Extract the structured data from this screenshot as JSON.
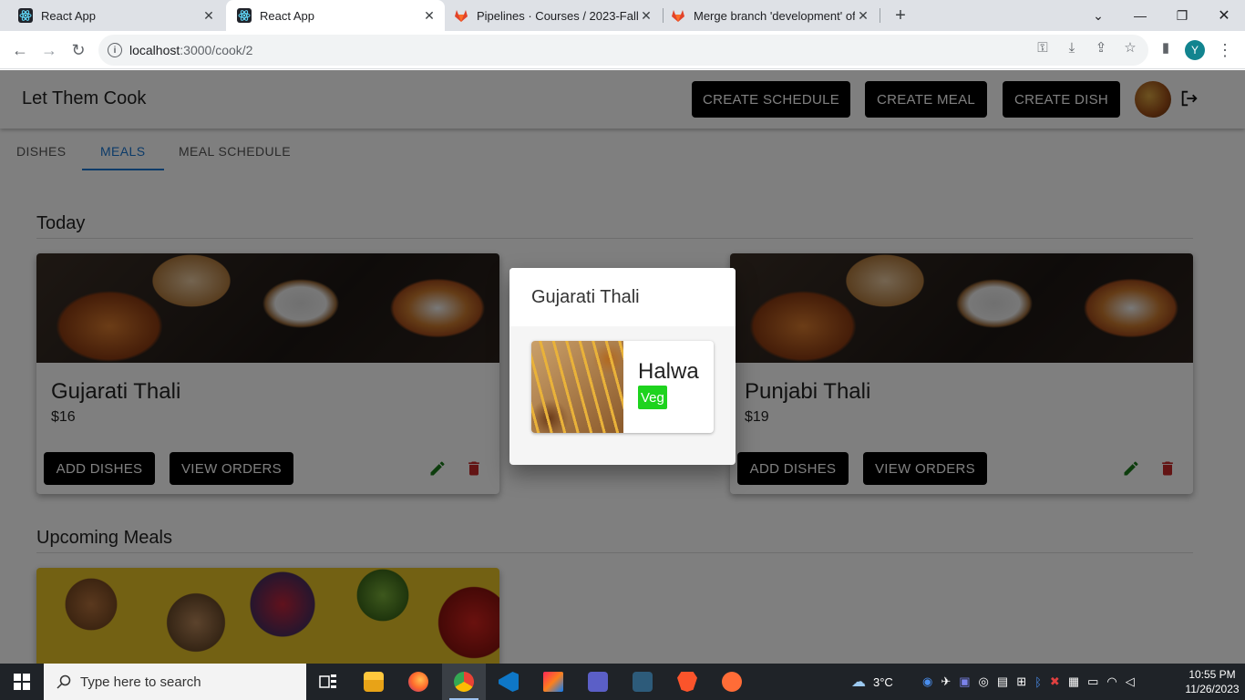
{
  "browser": {
    "tabs": [
      {
        "title": "React App",
        "active": false
      },
      {
        "title": "React App",
        "active": true
      },
      {
        "title": "Pipelines · Courses / 2023-Fall / C",
        "active": false
      },
      {
        "title": "Merge branch 'development' of",
        "active": false
      }
    ],
    "url_host": "localhost",
    "url_path": ":3000/cook/2",
    "profile_initial": "Y"
  },
  "app": {
    "brand": "Let Them Cook",
    "actions": {
      "create_schedule": "CREATE SCHEDULE",
      "create_meal": "CREATE MEAL",
      "create_dish": "CREATE DISH"
    },
    "tabs": [
      "DISHES",
      "MEALS",
      "MEAL SCHEDULE"
    ],
    "active_tab": "MEALS",
    "sections": {
      "today": "Today",
      "upcoming": "Upcoming Meals"
    },
    "today_meals": [
      {
        "name": "Gujarati Thali",
        "price": "$16",
        "add_label": "ADD DISHES",
        "view_label": "VIEW ORDERS"
      },
      {
        "name": "Punjabi Thali",
        "price": "$19",
        "add_label": "ADD DISHES",
        "view_label": "VIEW ORDERS"
      }
    ],
    "dialog": {
      "title": "Gujarati Thali",
      "dishes": [
        {
          "name": "Halwa",
          "tag": "Veg"
        }
      ]
    }
  },
  "taskbar": {
    "search_placeholder": "Type here to search",
    "weather": "3°C",
    "time": "10:55 PM",
    "date": "11/26/2023"
  },
  "colors": {
    "accent": "#1976d2",
    "veg_tag": "#1ed31e",
    "edit_icon": "#1b7a1b",
    "delete_icon": "#c62828"
  }
}
